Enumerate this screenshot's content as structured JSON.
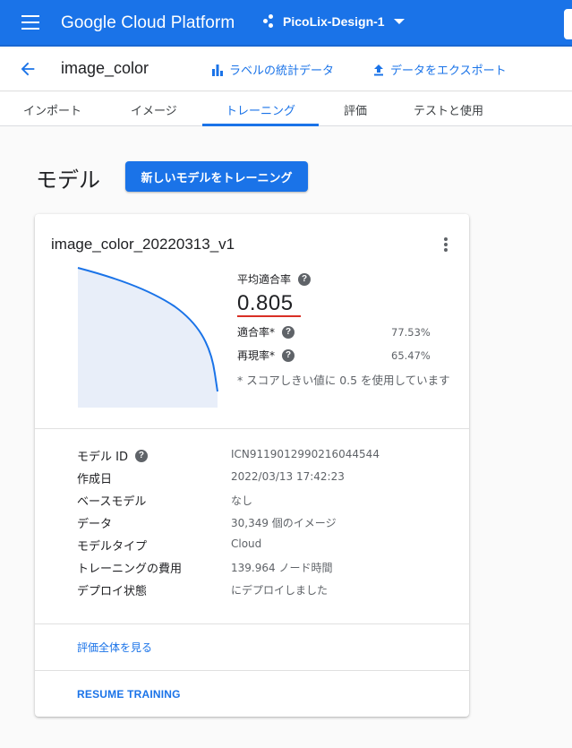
{
  "topbar": {
    "brand": "Google Cloud Platform",
    "project": "PicoLix-Design-1",
    "colors": {
      "bar": "#1a73e8",
      "text": "#ffffff"
    }
  },
  "subheader": {
    "title": "image_color",
    "label_stats": "ラベルの統計データ",
    "export": "データをエクスポート"
  },
  "tabs": [
    {
      "label": "インポート"
    },
    {
      "label": "イメージ"
    },
    {
      "label": "トレーニング",
      "active": true
    },
    {
      "label": "評価"
    },
    {
      "label": "テストと使用"
    }
  ],
  "models": {
    "section_title": "モデル",
    "train_button": "新しいモデルをトレーニング"
  },
  "card": {
    "model_name": "image_color_20220313_v1",
    "metrics": {
      "avg_precision_label": "平均適合率",
      "avg_precision_value": "0.805",
      "precision_label": "適合率*",
      "precision_value": "77.53%",
      "recall_label": "再現率*",
      "recall_value": "65.47%",
      "note": "* スコアしきい値に 0.5 を使用しています"
    },
    "details": [
      {
        "label": "モデル ID",
        "value": "ICN9119012990216044544",
        "help": true
      },
      {
        "label": "作成日",
        "value": "2022/03/13 17:42:23"
      },
      {
        "label": "ベースモデル",
        "value": "なし"
      },
      {
        "label": "データ",
        "value": "30,349 個のイメージ"
      },
      {
        "label": "モデルタイプ",
        "value": "Cloud"
      },
      {
        "label": "トレーニングの費用",
        "value": "139.964 ノード時間"
      },
      {
        "label": "デプロイ状態",
        "value": "にデプロイしました"
      }
    ],
    "view_eval_link": "評価全体を見る",
    "resume_training": "RESUME TRAINING"
  }
}
